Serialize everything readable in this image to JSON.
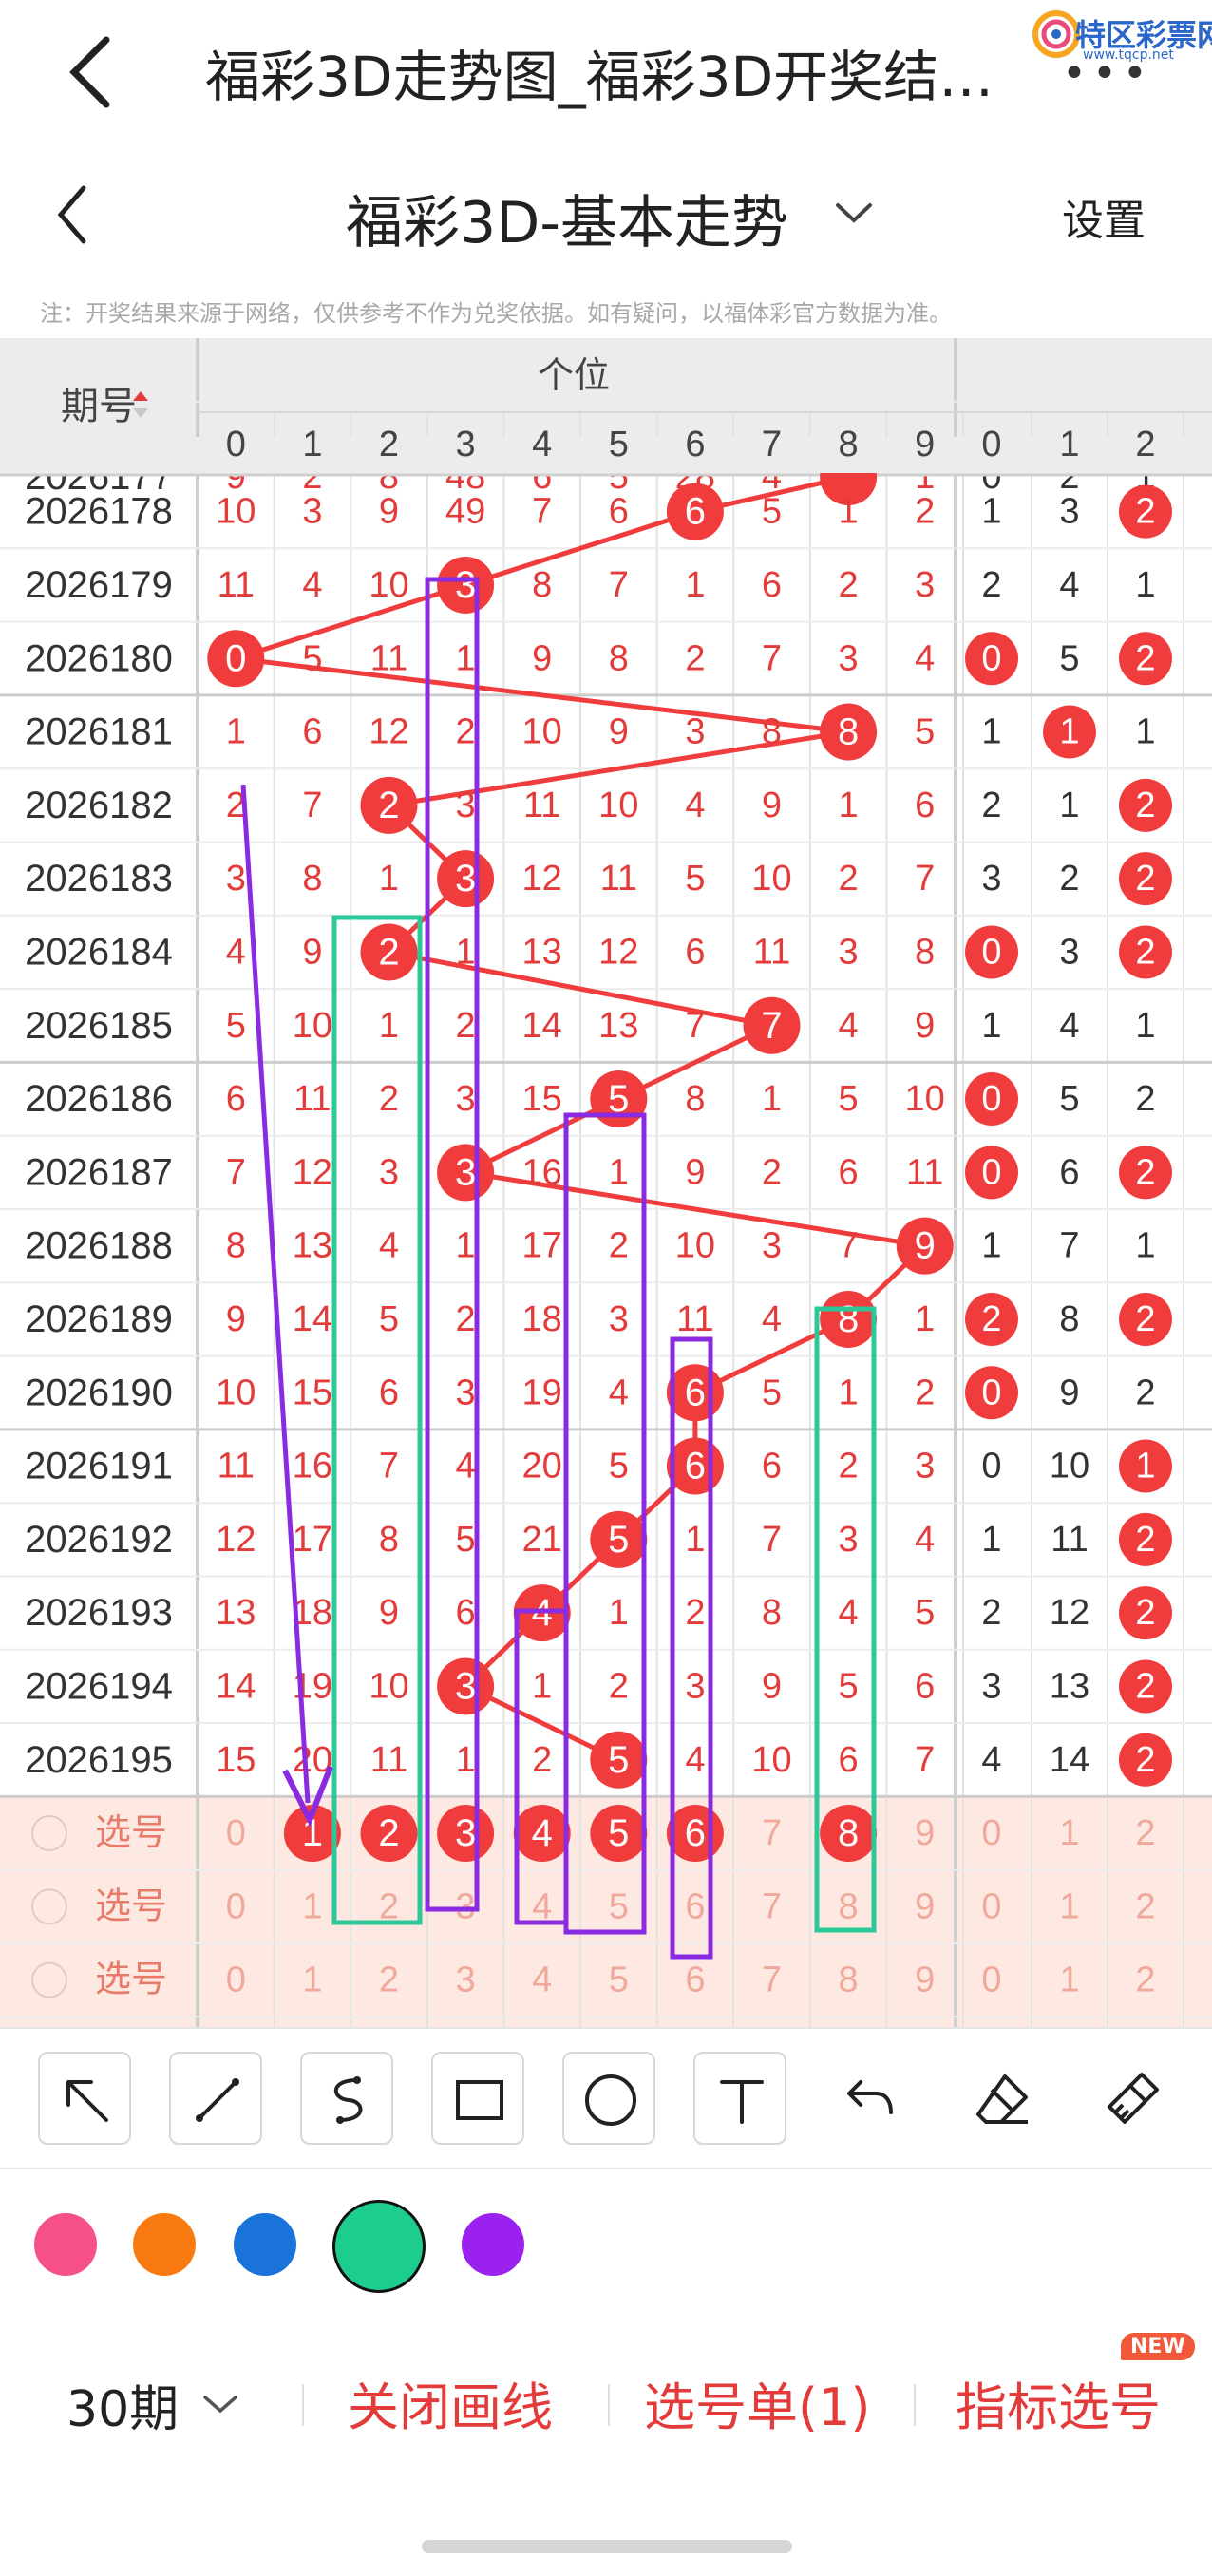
{
  "header": {
    "page_title": "福彩3D走势图_福彩3D开奖结…",
    "logo_text": "特区彩票网",
    "logo_url": "www.tqcp.net"
  },
  "subheader": {
    "title": "福彩3D-基本走势",
    "settings_label": "设置"
  },
  "notice": "注：开奖结果来源于网络，仅供参考不作为兑奖依据。如有疑问，以福体彩官方数据为准。",
  "table": {
    "period_header": "期号",
    "group_header": "个位",
    "digit_headers": [
      "0",
      "1",
      "2",
      "3",
      "4",
      "5",
      "6",
      "7",
      "8",
      "9"
    ],
    "extra_headers": [
      "0",
      "1",
      "2"
    ],
    "partial_row": {
      "label": "2026177",
      "cells": [
        "9",
        "2",
        "8",
        "48",
        "6",
        "5",
        "28",
        "4",
        "8",
        "1"
      ],
      "extra": [
        "0",
        "2",
        "1"
      ]
    },
    "rows": [
      {
        "label": "2026178",
        "cells": [
          "10",
          "3",
          "9",
          "49",
          "7",
          "6",
          "6",
          "5",
          "1",
          "2"
        ],
        "extra": [
          "1",
          "3",
          "2"
        ]
      },
      {
        "label": "2026179",
        "cells": [
          "11",
          "4",
          "10",
          "3",
          "8",
          "7",
          "1",
          "6",
          "2",
          "3"
        ],
        "extra": [
          "2",
          "4",
          "1"
        ]
      },
      {
        "label": "2026180",
        "cells": [
          "0",
          "5",
          "11",
          "1",
          "9",
          "8",
          "2",
          "7",
          "3",
          "4"
        ],
        "extra": [
          "0",
          "5",
          "2"
        ]
      },
      {
        "label": "2026181",
        "cells": [
          "1",
          "6",
          "12",
          "2",
          "10",
          "9",
          "3",
          "8",
          "8",
          "5"
        ],
        "extra": [
          "1",
          "1",
          "1"
        ]
      },
      {
        "label": "2026182",
        "cells": [
          "2",
          "7",
          "2",
          "3",
          "11",
          "10",
          "4",
          "9",
          "1",
          "6"
        ],
        "extra": [
          "2",
          "1",
          "2"
        ]
      },
      {
        "label": "2026183",
        "cells": [
          "3",
          "8",
          "1",
          "3",
          "12",
          "11",
          "5",
          "10",
          "2",
          "7"
        ],
        "extra": [
          "3",
          "2",
          "2"
        ]
      },
      {
        "label": "2026184",
        "cells": [
          "4",
          "9",
          "2",
          "1",
          "13",
          "12",
          "6",
          "11",
          "3",
          "8"
        ],
        "extra": [
          "0",
          "3",
          "2"
        ]
      },
      {
        "label": "2026185",
        "cells": [
          "5",
          "10",
          "1",
          "2",
          "14",
          "13",
          "7",
          "7",
          "4",
          "9"
        ],
        "extra": [
          "1",
          "4",
          "1"
        ]
      },
      {
        "label": "2026186",
        "cells": [
          "6",
          "11",
          "2",
          "3",
          "15",
          "5",
          "8",
          "1",
          "5",
          "10"
        ],
        "extra": [
          "0",
          "5",
          "2"
        ]
      },
      {
        "label": "2026187",
        "cells": [
          "7",
          "12",
          "3",
          "3",
          "16",
          "1",
          "9",
          "2",
          "6",
          "11"
        ],
        "extra": [
          "0",
          "6",
          "2"
        ]
      },
      {
        "label": "2026188",
        "cells": [
          "8",
          "13",
          "4",
          "1",
          "17",
          "2",
          "10",
          "3",
          "7",
          "9"
        ],
        "extra": [
          "1",
          "7",
          "1"
        ]
      },
      {
        "label": "2026189",
        "cells": [
          "9",
          "14",
          "5",
          "2",
          "18",
          "3",
          "11",
          "4",
          "8",
          "1"
        ],
        "extra": [
          "2",
          "8",
          "2"
        ]
      },
      {
        "label": "2026190",
        "cells": [
          "10",
          "15",
          "6",
          "3",
          "19",
          "4",
          "6",
          "5",
          "1",
          "2"
        ],
        "extra": [
          "0",
          "9",
          "2"
        ]
      },
      {
        "label": "2026191",
        "cells": [
          "11",
          "16",
          "7",
          "4",
          "20",
          "5",
          "6",
          "6",
          "2",
          "3"
        ],
        "extra": [
          "0",
          "10",
          "1"
        ]
      },
      {
        "label": "2026192",
        "cells": [
          "12",
          "17",
          "8",
          "5",
          "21",
          "5",
          "1",
          "7",
          "3",
          "4"
        ],
        "extra": [
          "1",
          "11",
          "2"
        ]
      },
      {
        "label": "2026193",
        "cells": [
          "13",
          "18",
          "9",
          "6",
          "4",
          "1",
          "2",
          "8",
          "4",
          "5"
        ],
        "extra": [
          "2",
          "12",
          "2"
        ]
      },
      {
        "label": "2026194",
        "cells": [
          "14",
          "19",
          "10",
          "3",
          "1",
          "2",
          "3",
          "9",
          "5",
          "6"
        ],
        "extra": [
          "3",
          "13",
          "2"
        ]
      },
      {
        "label": "2026195",
        "cells": [
          "15",
          "20",
          "11",
          "1",
          "2",
          "5",
          "4",
          "10",
          "6",
          "7"
        ],
        "extra": [
          "4",
          "14",
          "2"
        ]
      }
    ],
    "winning": [
      6,
      3,
      0,
      8,
      2,
      3,
      2,
      7,
      5,
      3,
      9,
      8,
      6,
      6,
      5,
      4,
      3,
      5
    ],
    "extra_hits": [
      [
        0,
        2
      ],
      [
        2,
        0
      ],
      [
        2,
        2
      ],
      [
        3,
        1
      ],
      [
        4,
        2
      ],
      [
        5,
        2
      ],
      [
        6,
        0
      ],
      [
        6,
        2
      ],
      [
        8,
        0
      ],
      [
        9,
        0
      ],
      [
        9,
        2
      ],
      [
        11,
        0
      ],
      [
        11,
        2
      ],
      [
        12,
        0
      ],
      [
        13,
        2
      ],
      [
        14,
        2
      ],
      [
        15,
        2
      ],
      [
        16,
        2
      ],
      [
        17,
        2
      ]
    ],
    "select_label": "选号",
    "select_rows": [
      {
        "cells": [
          "0",
          "1",
          "2",
          "3",
          "4",
          "5",
          "6",
          "7",
          "8",
          "9"
        ],
        "extra": [
          "0",
          "1",
          "2"
        ],
        "selected": [
          1,
          2,
          3,
          4,
          5,
          6,
          8
        ]
      },
      {
        "cells": [
          "0",
          "1",
          "2",
          "3",
          "4",
          "5",
          "6",
          "7",
          "8",
          "9"
        ],
        "extra": [
          "0",
          "1",
          "2"
        ],
        "selected": []
      },
      {
        "cells": [
          "0",
          "1",
          "2",
          "3",
          "4",
          "5",
          "6",
          "7",
          "8",
          "9"
        ],
        "extra": [
          "0",
          "1",
          "2"
        ],
        "selected": []
      }
    ]
  },
  "toolbar": {
    "tools": [
      "arrow-tool-icon",
      "line-tool-icon",
      "curve-tool-icon",
      "rectangle-tool-icon",
      "circle-tool-icon",
      "text-tool-icon",
      "undo-icon",
      "eraser-icon",
      "clear-brush-icon"
    ],
    "colors": [
      "#f5508a",
      "#fa7a12",
      "#1a73d9",
      "#1ccd8e",
      "#9b22ee"
    ],
    "selected_color": 3
  },
  "bottom": {
    "period_label": "30期",
    "close_lines": "关闭画线",
    "selection_list": "选号单(1)",
    "indicator_select": "指标选号",
    "new_badge": "NEW"
  },
  "colors": {
    "red": "#e33a3a",
    "ball": "#f03c3c",
    "header_bg": "#ececec",
    "select_bg": "#fde9e2"
  }
}
